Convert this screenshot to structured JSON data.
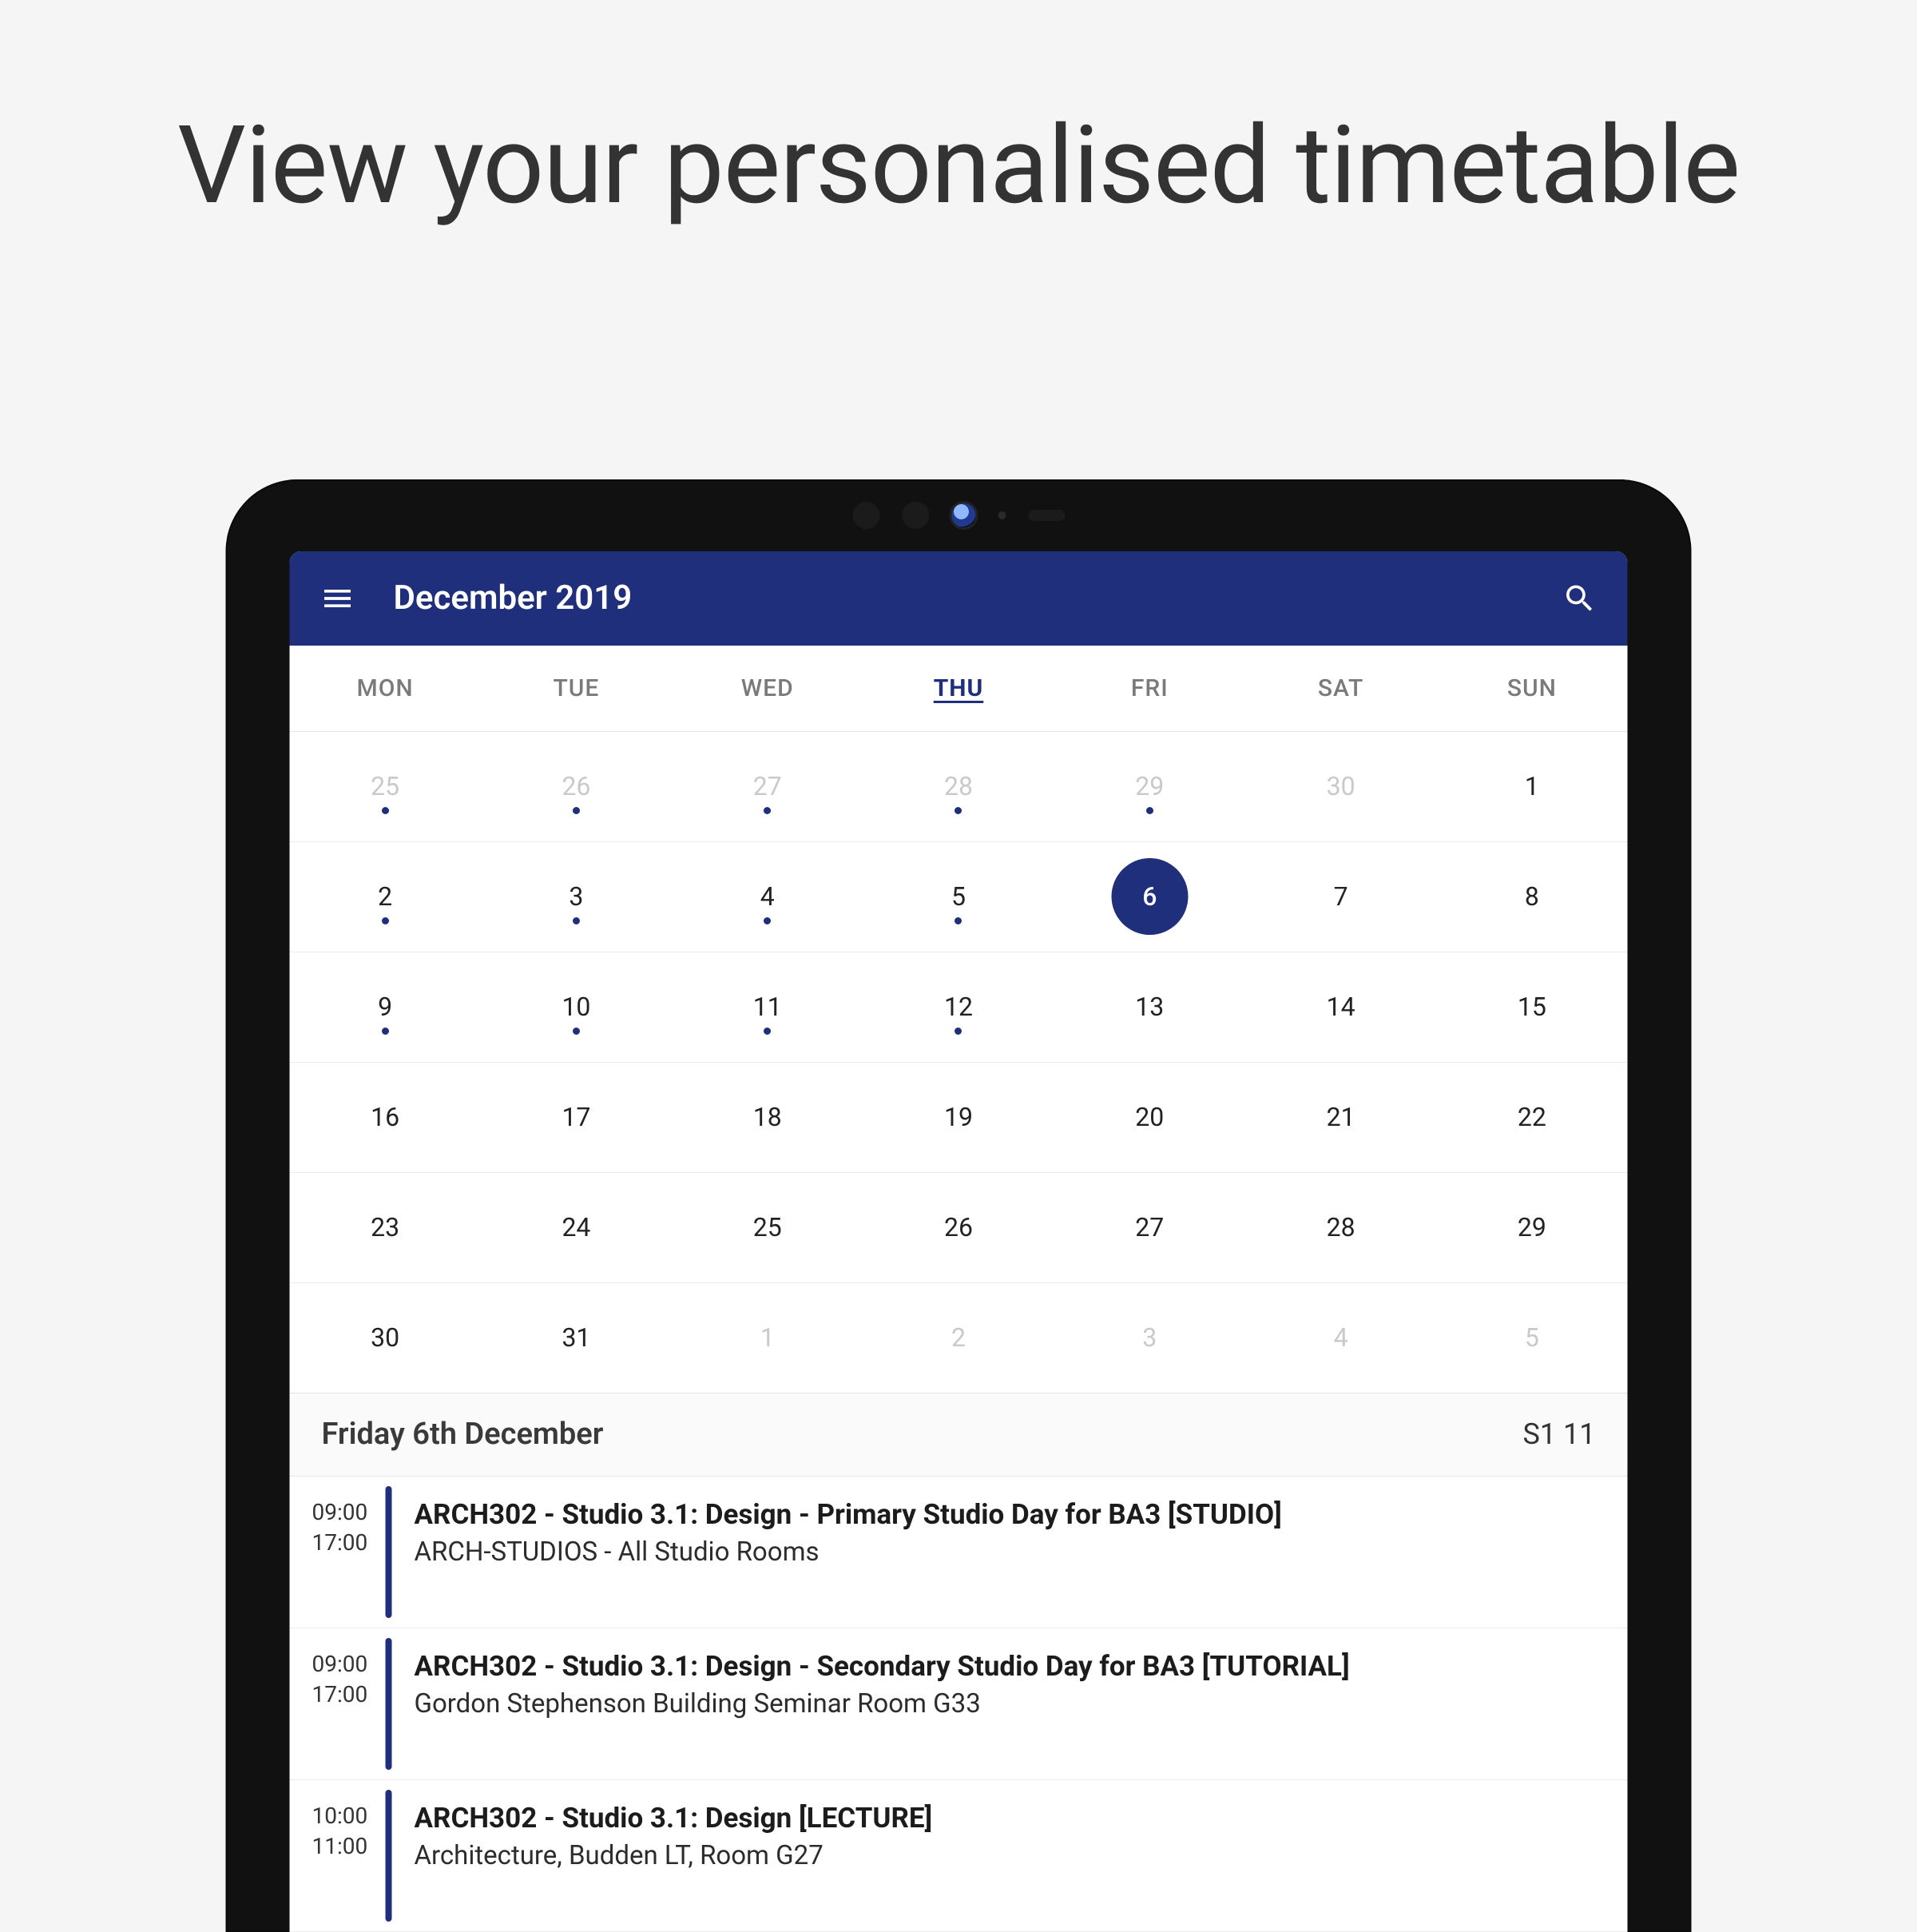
{
  "headline": "View your personalised timetable",
  "appbar": {
    "title": "December 2019",
    "menu_icon": "menu-icon",
    "search_icon": "search-icon"
  },
  "calendar": {
    "dow": [
      "MON",
      "TUE",
      "WED",
      "THU",
      "FRI",
      "SAT",
      "SUN"
    ],
    "today_index": 3,
    "weeks": [
      [
        {
          "n": "25",
          "out": true,
          "dot": true
        },
        {
          "n": "26",
          "out": true,
          "dot": true
        },
        {
          "n": "27",
          "out": true,
          "dot": true
        },
        {
          "n": "28",
          "out": true,
          "dot": true
        },
        {
          "n": "29",
          "out": true,
          "dot": true
        },
        {
          "n": "30",
          "out": true,
          "dot": false
        },
        {
          "n": "1",
          "out": false,
          "dot": false
        }
      ],
      [
        {
          "n": "2",
          "out": false,
          "dot": true
        },
        {
          "n": "3",
          "out": false,
          "dot": true
        },
        {
          "n": "4",
          "out": false,
          "dot": true
        },
        {
          "n": "5",
          "out": false,
          "dot": true
        },
        {
          "n": "6",
          "out": false,
          "dot": false,
          "selected": true
        },
        {
          "n": "7",
          "out": false,
          "dot": false
        },
        {
          "n": "8",
          "out": false,
          "dot": false
        }
      ],
      [
        {
          "n": "9",
          "out": false,
          "dot": true
        },
        {
          "n": "10",
          "out": false,
          "dot": true
        },
        {
          "n": "11",
          "out": false,
          "dot": true
        },
        {
          "n": "12",
          "out": false,
          "dot": true
        },
        {
          "n": "13",
          "out": false,
          "dot": false
        },
        {
          "n": "14",
          "out": false,
          "dot": false
        },
        {
          "n": "15",
          "out": false,
          "dot": false
        }
      ],
      [
        {
          "n": "16",
          "out": false,
          "dot": false
        },
        {
          "n": "17",
          "out": false,
          "dot": false
        },
        {
          "n": "18",
          "out": false,
          "dot": false
        },
        {
          "n": "19",
          "out": false,
          "dot": false
        },
        {
          "n": "20",
          "out": false,
          "dot": false
        },
        {
          "n": "21",
          "out": false,
          "dot": false
        },
        {
          "n": "22",
          "out": false,
          "dot": false
        }
      ],
      [
        {
          "n": "23",
          "out": false,
          "dot": false
        },
        {
          "n": "24",
          "out": false,
          "dot": false
        },
        {
          "n": "25",
          "out": false,
          "dot": false
        },
        {
          "n": "26",
          "out": false,
          "dot": false
        },
        {
          "n": "27",
          "out": false,
          "dot": false
        },
        {
          "n": "28",
          "out": false,
          "dot": false
        },
        {
          "n": "29",
          "out": false,
          "dot": false
        }
      ],
      [
        {
          "n": "30",
          "out": false,
          "dot": false
        },
        {
          "n": "31",
          "out": false,
          "dot": false
        },
        {
          "n": "1",
          "out": true,
          "dot": false
        },
        {
          "n": "2",
          "out": true,
          "dot": false
        },
        {
          "n": "3",
          "out": true,
          "dot": false
        },
        {
          "n": "4",
          "out": true,
          "dot": false
        },
        {
          "n": "5",
          "out": true,
          "dot": false
        }
      ]
    ]
  },
  "agenda": {
    "date_label": "Friday 6th December",
    "meta": "S1 11",
    "events": [
      {
        "start": "09:00",
        "end": "17:00",
        "title": "ARCH302 - Studio 3.1: Design - Primary Studio Day for BA3 [STUDIO]",
        "location": "ARCH-STUDIOS - All Studio Rooms"
      },
      {
        "start": "09:00",
        "end": "17:00",
        "title": "ARCH302 - Studio 3.1: Design - Secondary Studio Day for BA3 [TUTORIAL]",
        "location": "Gordon Stephenson Building Seminar Room G33"
      },
      {
        "start": "10:00",
        "end": "11:00",
        "title": "ARCH302 - Studio 3.1: Design [LECTURE]",
        "location": "Architecture, Budden LT, Room G27"
      }
    ]
  }
}
